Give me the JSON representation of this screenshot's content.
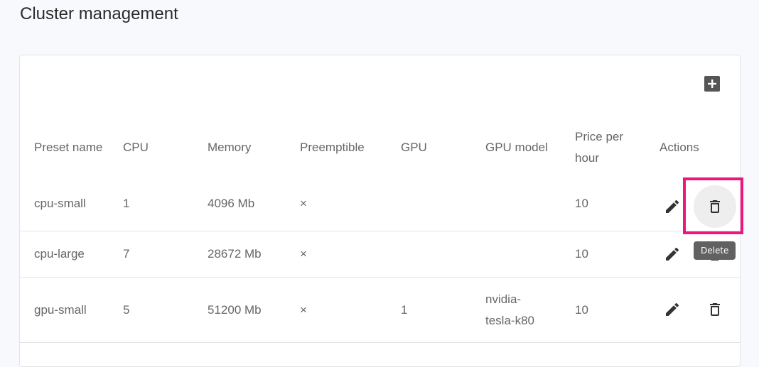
{
  "page": {
    "title": "Cluster management"
  },
  "table": {
    "headers": {
      "preset_name": "Preset name",
      "cpu": "CPU",
      "memory": "Memory",
      "preemptible": "Preemptible",
      "gpu": "GPU",
      "gpu_model": "GPU model",
      "price_per_hour": "Price per hour",
      "actions": "Actions"
    },
    "rows": [
      {
        "preset_name": "cpu-small",
        "cpu": "1",
        "memory": "4096 Mb",
        "preemptible": "×",
        "gpu": "",
        "gpu_model": "",
        "price_per_hour": "10"
      },
      {
        "preset_name": "cpu-large",
        "cpu": "7",
        "memory": "28672 Mb",
        "preemptible": "×",
        "gpu": "",
        "gpu_model": "",
        "price_per_hour": "10"
      },
      {
        "preset_name": "gpu-small",
        "cpu": "5",
        "memory": "51200 Mb",
        "preemptible": "×",
        "gpu": "1",
        "gpu_model": "nvidia-tesla-k80",
        "price_per_hour": "10"
      }
    ]
  },
  "icons": {
    "add": "add-box-icon",
    "edit": "pencil-icon",
    "delete": "trash-icon"
  },
  "tooltip": {
    "text": "Delete"
  },
  "colors": {
    "highlight": "#f0147e",
    "tooltip_bg": "#616161",
    "icon": "#333333"
  }
}
